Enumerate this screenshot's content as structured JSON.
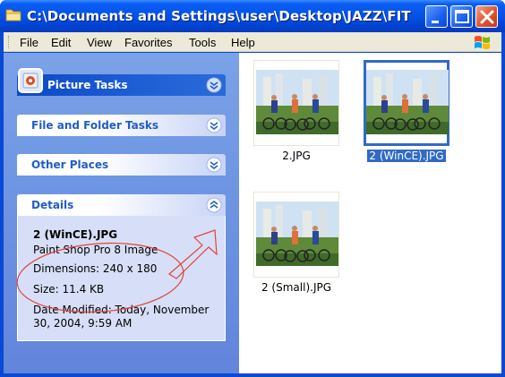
{
  "window": {
    "title": "C:\\Documents and Settings\\user\\Desktop\\JAZZ\\FIT",
    "colors": {
      "titlebar": "#0452e6",
      "close": "#e0532c",
      "selection": "#316ac5",
      "taskpane": "#6f96e2"
    }
  },
  "menu": {
    "items": [
      {
        "label": "File"
      },
      {
        "label": "Edit"
      },
      {
        "label": "View"
      },
      {
        "label": "Favorites"
      },
      {
        "label": "Tools"
      },
      {
        "label": "Help"
      }
    ]
  },
  "taskpane": {
    "picture_tasks": {
      "label": "Picture Tasks",
      "icon": "picture-icon",
      "state": "collapsed"
    },
    "file_folder_tasks": {
      "label": "File and Folder Tasks",
      "state": "collapsed"
    },
    "other_places": {
      "label": "Other Places",
      "state": "collapsed"
    },
    "details": {
      "label": "Details",
      "state": "expanded",
      "filename": "2 (WinCE).JPG",
      "type": "Paint Shop Pro 8 Image",
      "dimensions": "Dimensions: 240 x 180",
      "size": "Size: 11.4 KB",
      "date_line1": "Date Modified: Today, November",
      "date_line2": "30, 2004, 9:59 AM"
    }
  },
  "files": [
    {
      "name": "2.JPG",
      "selected": false
    },
    {
      "name": "2 (WinCE).JPG",
      "selected": true
    },
    {
      "name": "2 (Small).JPG",
      "selected": false
    }
  ]
}
